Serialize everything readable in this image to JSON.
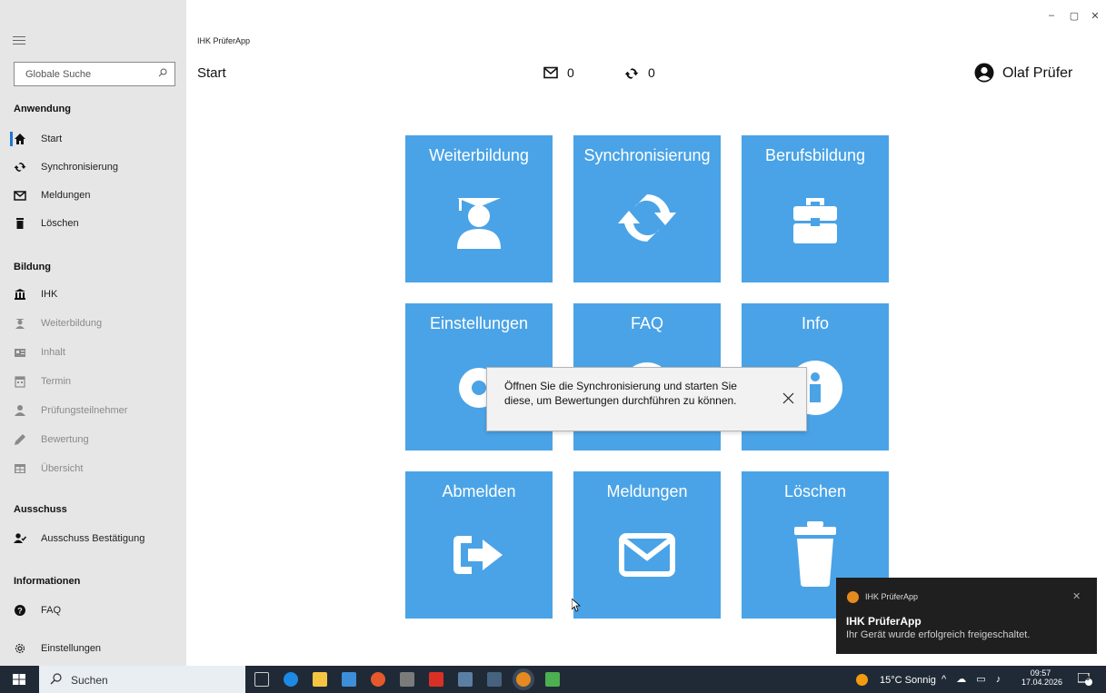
{
  "window": {
    "app_title": "IHK PrüferApp",
    "controls": {
      "minimize": "–",
      "maximize": "▢",
      "close": "✕"
    }
  },
  "sidebar": {
    "search": {
      "placeholder": "Globale Suche",
      "icon": "search-icon"
    },
    "sections": {
      "anwendung": "Anwendung",
      "bildung": "Bildung",
      "ausschuss": "Ausschuss",
      "informationen": "Informationen"
    },
    "items": {
      "start": {
        "label": "Start",
        "icon": "home-icon"
      },
      "sync": {
        "label": "Synchronisierung",
        "icon": "sync-icon"
      },
      "meldungen": {
        "label": "Meldungen",
        "icon": "envelope-icon"
      },
      "loeschen": {
        "label": "Löschen",
        "icon": "trash-icon"
      },
      "ihk": {
        "label": "IHK",
        "icon": "institution-icon"
      },
      "weiterbildung": {
        "label": "Weiterbildung",
        "icon": "graduate-icon"
      },
      "inhalt": {
        "label": "Inhalt",
        "icon": "id-card-icon"
      },
      "termin": {
        "label": "Termin",
        "icon": "calendar-icon"
      },
      "pruefungsteilnehmer": {
        "label": "Prüfungsteilnehmer",
        "icon": "user-icon"
      },
      "bewertung": {
        "label": "Bewertung",
        "icon": "pencil-icon"
      },
      "uebersicht": {
        "label": "Übersicht",
        "icon": "table-icon"
      },
      "ausschuss_bestaetigung": {
        "label": "Ausschuss Bestätigung",
        "icon": "user-check-icon"
      },
      "faq": {
        "label": "FAQ",
        "icon": "question-icon"
      },
      "einstellungen": {
        "label": "Einstellungen",
        "icon": "gear-icon"
      }
    },
    "selected": "start"
  },
  "header": {
    "page_title": "Start",
    "messages_count": "0",
    "sync_count": "0",
    "user_name": "Olaf Prüfer"
  },
  "tiles": [
    {
      "label": "Weiterbildung",
      "icon": "graduate-icon"
    },
    {
      "label": "Synchronisierung",
      "icon": "sync-icon"
    },
    {
      "label": "Berufsbildung",
      "icon": "toolbox-icon"
    },
    {
      "label": "Einstellungen",
      "icon": "gear-icon"
    },
    {
      "label": "FAQ",
      "icon": "question-icon"
    },
    {
      "label": "Info",
      "icon": "info-icon"
    },
    {
      "label": "Abmelden",
      "icon": "sign-out-icon"
    },
    {
      "label": "Meldungen",
      "icon": "envelope-icon"
    },
    {
      "label": "Löschen",
      "icon": "trash-icon"
    }
  ],
  "tooltip": {
    "text": "Öffnen Sie die Synchronisierung und starten Sie diese, um Bewertungen durchführen zu können."
  },
  "toast": {
    "app_name": "IHK PrüferApp",
    "title": "IHK PrüferApp",
    "message": "Ihr Gerät wurde erfolgreich freigeschaltet."
  },
  "taskbar": {
    "search_label": "Suchen",
    "weather": "15°C Sonnig",
    "time": "09:57",
    "date": "17.04.2026",
    "notification_count": "3"
  },
  "colors": {
    "tile": "#4aa3e6",
    "sidebar": "#e6e6e6",
    "accent": "#1f78d1",
    "taskbar": "#202a36"
  }
}
